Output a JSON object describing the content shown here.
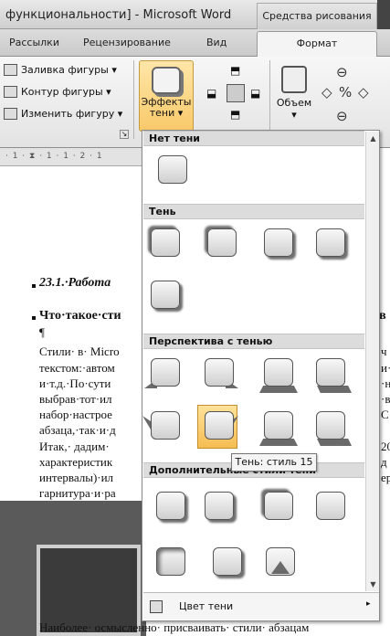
{
  "window": {
    "title": "функциональности] - Microsoft Word",
    "context_tab": "Средства рисования"
  },
  "tabs": {
    "mailings": "Рассылки",
    "review": "Рецензирование",
    "view": "Вид",
    "format": "Формат"
  },
  "ribbon": {
    "fill": "Заливка фигуры ▾",
    "outline": "Контур фигуры ▾",
    "change": "Изменить фигуру ▾",
    "shadow_effects": "Эффекты",
    "shadow_effects2": "тени ▾",
    "volume": "Объем",
    "volume_arrow": "▾"
  },
  "ruler": {
    "text": "· 1 · ⧗ · 1 · 1 · 2 · 1"
  },
  "document": {
    "heading1": "23.1.·Работа",
    "heading2": "Что·такое·сти",
    "heading2_right": "кв",
    "pilcrow": "¶",
    "lines_left": [
      "Стили· в· Micro",
      "текстом:·автом",
      "и·т.д.·По·сути",
      "выбрав·тот·ил",
      "набор·настрое",
      "абзаца,·так·и·д",
      "Итак,· дадим·",
      "характеристик",
      "интервалы)·ил",
      "гарнитура·и·ра"
    ],
    "lines_right": [
      "ч",
      "и·",
      "·н",
      "·в",
      "С",
      "",
      "20",
      "д",
      "ер",
      ""
    ],
    "pilcrow2": "¶",
    "last_line": "Наиболее· осмысленно· присваивать· стили· абзацам"
  },
  "panel": {
    "sections": [
      "Нет тени",
      "Тень",
      "Перспектива с тенью",
      "Дополнительные стили тени"
    ],
    "tooltip": "Тень: стиль 15",
    "shadow_color": "Цвет тени",
    "shadow_color_arrow": "▸",
    "scroll_up": "▲",
    "scroll_down": "▼"
  }
}
